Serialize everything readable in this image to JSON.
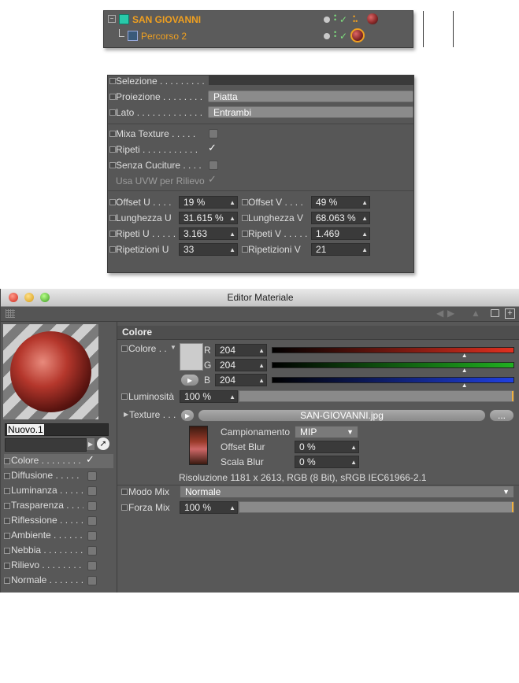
{
  "object_manager": {
    "rows": [
      {
        "name": "SAN GIOVANNI"
      },
      {
        "name": "Percorso 2"
      }
    ]
  },
  "attributes": {
    "selezione": {
      "label": "Selezione",
      "dots": " . . . . . . . . ."
    },
    "proiezione": {
      "label": "Proiezione",
      "dots": " . . . . . . . .",
      "value": "Piatta"
    },
    "lato": {
      "label": "Lato",
      "dots": " . . . . . . . . . . . . .",
      "value": "Entrambi"
    },
    "mixa_texture": {
      "label": "Mixa Texture",
      "dots": " . . . . .",
      "checked": false
    },
    "ripeti": {
      "label": "Ripeti",
      "dots": " . . . . . . . . . . .",
      "checked": true
    },
    "senza_cuciture": {
      "label": "Senza Cuciture",
      "dots": " . . . .",
      "checked": false
    },
    "usa_uvw": {
      "label": "Usa UVW per Rilievo",
      "checked": true
    },
    "offset_u": {
      "label": "Offset U",
      "dots": " . . . .",
      "value": "19 %"
    },
    "offset_v": {
      "label": "Offset V",
      "dots": " . . . .",
      "value": "49 %"
    },
    "lunghezza_u": {
      "label": "Lunghezza U",
      "value": "31.615 %"
    },
    "lunghezza_v": {
      "label": "Lunghezza V",
      "value": "68.063 %"
    },
    "ripeti_u": {
      "label": "Ripeti U",
      "dots": ". . . . .",
      "value": "3.163"
    },
    "ripeti_v": {
      "label": "Ripeti V",
      "dots": ". . . . .",
      "value": "1.469"
    },
    "ripetizioni_u": {
      "label": "Ripetizioni U",
      "value": "33"
    },
    "ripetizioni_v": {
      "label": "Ripetizioni V",
      "value": "21"
    }
  },
  "editor": {
    "title": "Editor Materiale",
    "material_name": "Nuovo.1",
    "channels": [
      {
        "name": "Colore",
        "dots": ". . . . . . . .",
        "checked": true,
        "selected": true
      },
      {
        "name": "Diffusione",
        "dots": ". . . . .",
        "checked": false
      },
      {
        "name": "Luminanza",
        "dots": ". . . . .",
        "checked": false
      },
      {
        "name": "Trasparenza",
        "dots": ". . . .",
        "checked": false
      },
      {
        "name": "Riflessione",
        "dots": ". . . . .",
        "checked": false
      },
      {
        "name": "Ambiente",
        "dots": ". . . . . . .",
        "checked": false
      },
      {
        "name": "Nebbia",
        "dots": ". . . . . . . . .",
        "checked": false
      },
      {
        "name": "Rilievo",
        "dots": ". . . . . . . . .",
        "checked": false
      },
      {
        "name": "Normale",
        "dots": ". . . . . . . .",
        "checked": false
      }
    ],
    "section_title": "Colore",
    "colore_label": "Colore",
    "colore_dots": ". .",
    "r": {
      "label": "R",
      "value": "204",
      "fraction": 0.8
    },
    "g": {
      "label": "G",
      "value": "204",
      "fraction": 0.8
    },
    "b": {
      "label": "B",
      "value": "204",
      "fraction": 0.8
    },
    "swatch_color": "#cccccc",
    "luminosita": {
      "label": "Luminosità",
      "value": "100 %",
      "fraction": 1.0
    },
    "texture": {
      "label": "Texture",
      "dots": ". . .",
      "file": "SAN-GIOVANNI.jpg",
      "more": "..."
    },
    "campionamento": {
      "label": "Campionamento",
      "value": "MIP"
    },
    "offset_blur": {
      "label": "Offset Blur",
      "value": "0 %"
    },
    "scala_blur": {
      "label": "Scala Blur",
      "value": "0 %"
    },
    "risoluzione": "Risoluzione 1181 x 2613, RGB (8 Bit), sRGB IEC61966-2.1",
    "modo_mix": {
      "label": "Modo Mix",
      "value": "Normale"
    },
    "forza_mix": {
      "label": "Forza Mix",
      "value": "100 %",
      "fraction": 1.0
    }
  },
  "colors": {
    "object_orange": "#f0a020",
    "red_channel": "#e03020",
    "green_channel": "#20b020",
    "blue_channel": "#2040e0",
    "slider_end": "#f0b040"
  }
}
